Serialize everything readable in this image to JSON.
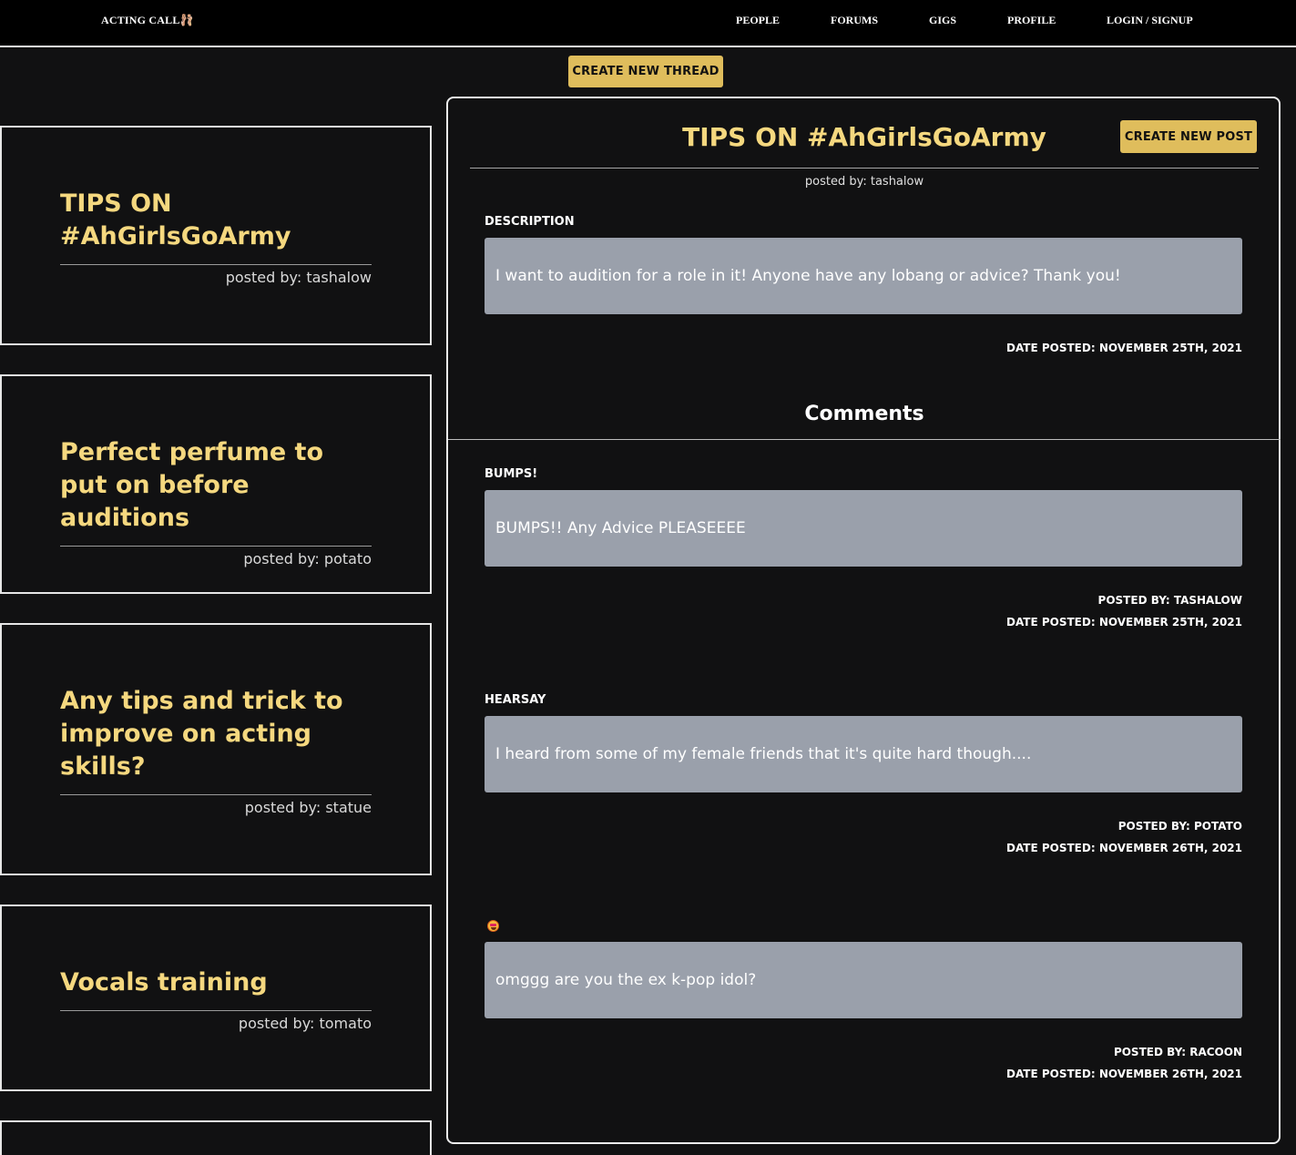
{
  "nav": {
    "brand": "ACTING CALL🩰",
    "links": [
      "PEOPLE",
      "FORUMS",
      "GIGS",
      "PROFILE",
      "LOGIN / SIGNUP"
    ]
  },
  "actions": {
    "create_thread_label": "CREATE NEW THREAD",
    "create_post_label": "CREATE NEW POST"
  },
  "threads": [
    {
      "title": "TIPS ON #AhGirlsGoArmy",
      "author": "posted by: tashalow"
    },
    {
      "title": "Perfect perfume to put on before auditions",
      "author": "posted by: potato"
    },
    {
      "title": "Any tips and trick to improve on acting skills?",
      "author": "posted by: statue"
    },
    {
      "title": "Vocals training",
      "author": "posted by: tomato"
    }
  ],
  "detail": {
    "title": "TIPS ON #AhGirlsGoArmy",
    "author": "posted by: tashalow",
    "description_label": "DESCRIPTION",
    "description": "I want to audition for a role in it! Anyone have any lobang or advice? Thank you!",
    "date_posted": "DATE POSTED: NOVEMBER 25TH, 2021",
    "comments_heading": "Comments",
    "comments": [
      {
        "title": "BUMPS!",
        "body": "BUMPS!! Any Advice PLEASEEEE",
        "posted_by": "POSTED BY: TASHALOW",
        "date": "DATE POSTED: NOVEMBER 25TH, 2021"
      },
      {
        "title": "HEARSAY",
        "body": "I heard from some of my female friends that it's quite hard though....",
        "posted_by": "POSTED BY: POTATO",
        "date": "DATE POSTED: NOVEMBER 26TH, 2021"
      },
      {
        "title_icon": "star-struck-emoji-icon",
        "body": "omggg are you the ex k-pop idol?",
        "posted_by": "POSTED BY: RACOON",
        "date": "DATE POSTED: NOVEMBER 26TH, 2021"
      }
    ]
  },
  "colors": {
    "background": "#111112",
    "accent_gold": "#dfbd5c",
    "title_yellow": "#f5d87f",
    "message_box": "#9aa0ab"
  }
}
